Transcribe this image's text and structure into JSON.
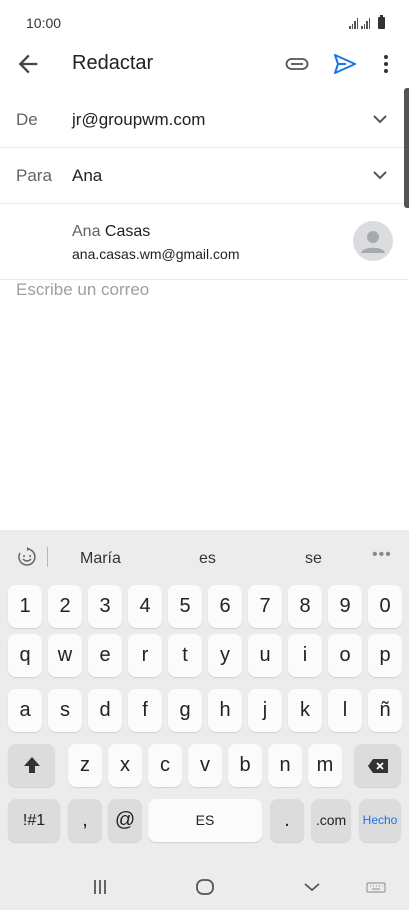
{
  "status_bar": {
    "time": "10:00"
  },
  "app_bar": {
    "title": "Redactar"
  },
  "fields": {
    "from": {
      "label": "De",
      "value": "jr@groupwm.com"
    },
    "to": {
      "label": "Para",
      "value": "Ana"
    }
  },
  "suggestion": {
    "name_typed": "Ana",
    "name_rest": "Casas",
    "email": "ana.casas.wm@gmail.com"
  },
  "compose": {
    "placeholder": "Escribe un correo"
  },
  "keyboard": {
    "suggestions": [
      "María",
      "es",
      "se"
    ],
    "more_label": "•••",
    "row_numbers": [
      "1",
      "2",
      "3",
      "4",
      "5",
      "6",
      "7",
      "8",
      "9",
      "0"
    ],
    "row_top": [
      "q",
      "w",
      "e",
      "r",
      "t",
      "y",
      "u",
      "i",
      "o",
      "p"
    ],
    "row_mid": [
      "a",
      "s",
      "d",
      "f",
      "g",
      "h",
      "j",
      "k",
      "l",
      "ñ"
    ],
    "row_bottom": [
      "z",
      "x",
      "c",
      "v",
      "b",
      "n",
      "m"
    ],
    "sym_label": "!#1",
    "comma": ",",
    "at": "@",
    "space_label": "ES",
    "period": ".",
    "dotcom": ".com",
    "done_label": "Hecho"
  },
  "colors": {
    "accent": "#1a73e8",
    "keyboard_bg": "#ececec",
    "key_bg": "#fbfbfb"
  }
}
